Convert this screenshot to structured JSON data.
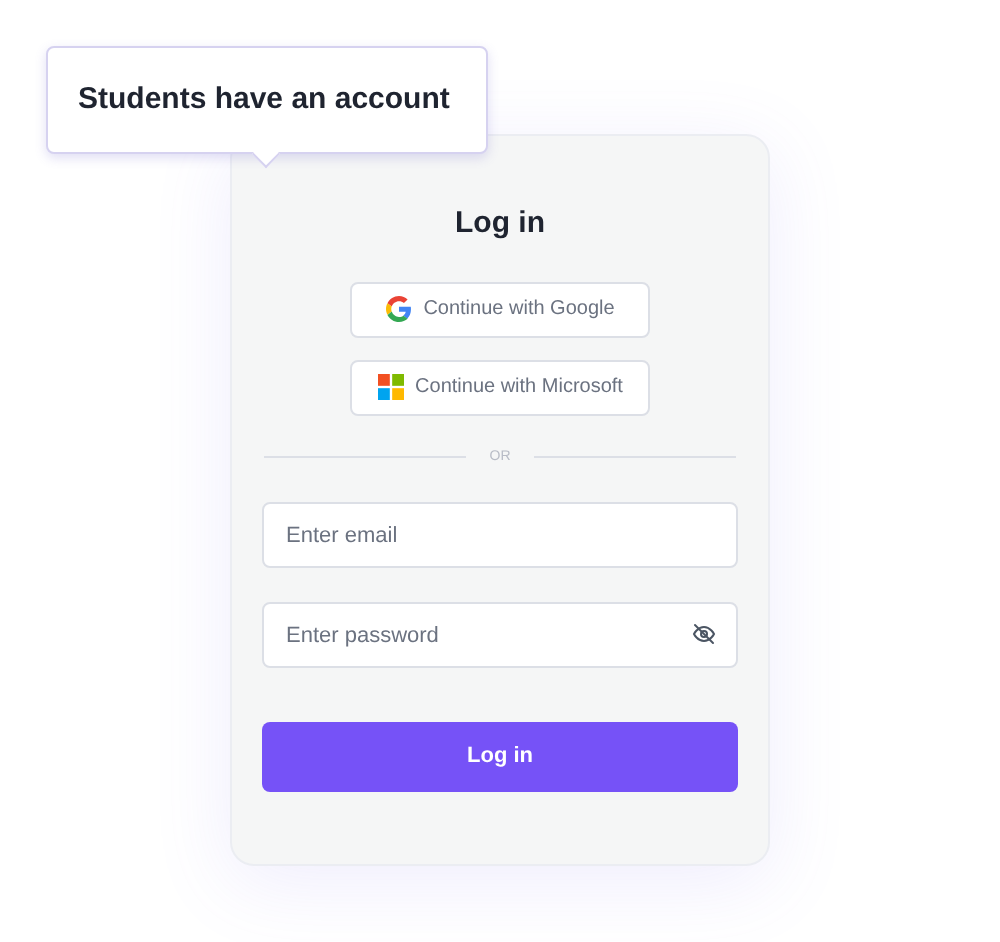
{
  "tooltip": {
    "text": "Students have an account"
  },
  "title": "Log in",
  "providers": [
    {
      "kind": "google",
      "label": "Continue with Google"
    },
    {
      "kind": "microsoft",
      "label": "Continue with Microsoft"
    }
  ],
  "divider": "OR",
  "email": {
    "placeholder": "Enter email"
  },
  "password": {
    "placeholder": "Enter password"
  },
  "submit": "Log in"
}
